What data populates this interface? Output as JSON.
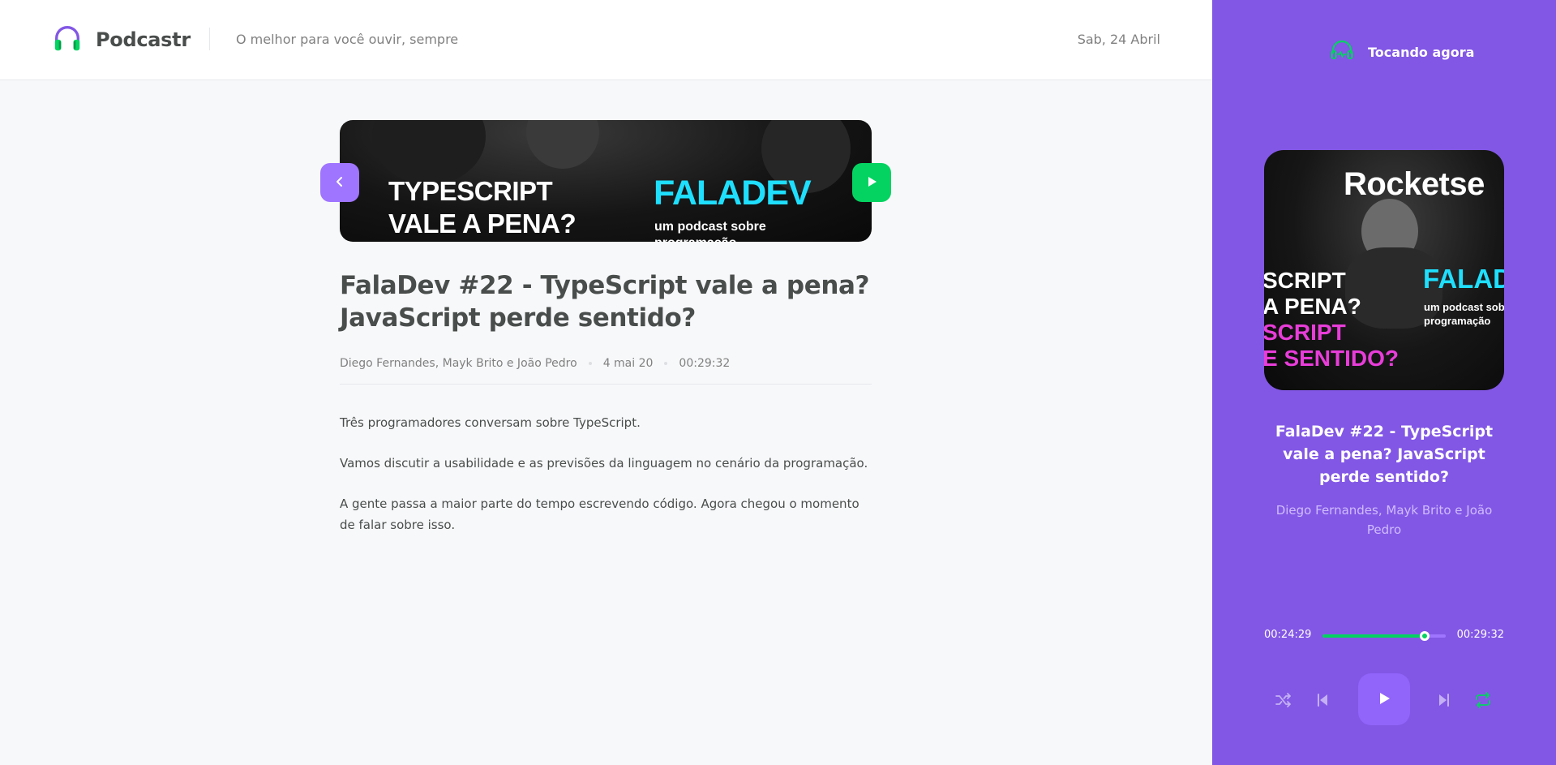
{
  "header": {
    "logo_text": "Podcastr",
    "tagline": "O melhor para você ouvir, sempre",
    "date": "Sab, 24 Abril"
  },
  "episode": {
    "title": "FalaDev #22 - TypeScript vale a pena? JavaScript perde sentido?",
    "members": "Diego Fernandes, Mayk Brito e João Pedro",
    "published": "4 mai 20",
    "duration": "00:29:32",
    "description": [
      "Três programadores conversam sobre TypeScript.",
      "Vamos discutir a usabilidade e as previsões da linguagem no cenário da programação.",
      "A gente passa a maior parte do tempo escrevendo código. Agora chegou o momento de falar sobre isso."
    ],
    "thumbnail": {
      "left_line1": "TYPESCRIPT",
      "left_line2": "VALE A PENA?",
      "right_title": "FALADEV",
      "right_sub1": "um podcast sobre",
      "right_sub2": "programação"
    }
  },
  "player": {
    "heading": "Tocando agora",
    "title": "FalaDev #22 - TypeScript vale a pena? JavaScript perde sentido?",
    "members": "Diego Fernandes, Mayk Brito e João Pedro",
    "current_time": "00:24:29",
    "total_time": "00:29:32",
    "progress_fraction": 0.83,
    "cover": {
      "brand": "Rocketse",
      "left_line1": "SCRIPT",
      "left_line2": "A PENA?",
      "left_line3": "SCRIPT",
      "left_line4": "E SENTIDO?",
      "right_title": "FALAD",
      "right_sub1": "um podcast sob",
      "right_sub2": "programação"
    }
  },
  "colors": {
    "purple": "#8257e5",
    "purple_light": "#9f75ff",
    "green": "#04d361",
    "cyan": "#1fdffe"
  },
  "icons": {
    "logo": "headphones-icon",
    "now_playing": "headphones-pulse-icon",
    "back": "chevron-left-icon",
    "play": "play-icon",
    "shuffle": "shuffle-icon",
    "prev": "skip-previous-icon",
    "next": "skip-next-icon",
    "repeat": "repeat-icon"
  }
}
